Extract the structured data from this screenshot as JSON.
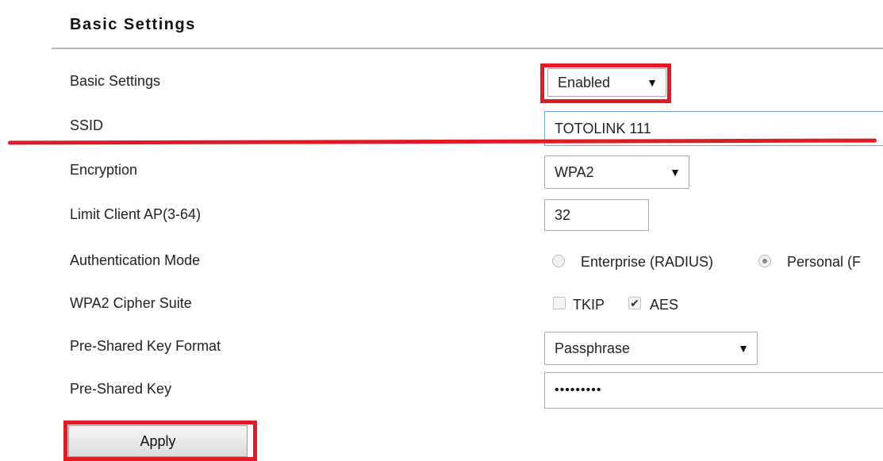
{
  "page": {
    "section_title": "Basic Settings"
  },
  "rows": {
    "basic_settings": {
      "label": "Basic Settings",
      "value": "Enabled"
    },
    "ssid": {
      "label": "SSID",
      "value": "TOTOLINK 111"
    },
    "encryption": {
      "label": "Encryption",
      "value": "WPA2"
    },
    "limit_client": {
      "label": "Limit Client AP(3-64)",
      "value": "32"
    },
    "auth_mode": {
      "label": "Authentication Mode",
      "options": [
        {
          "label": "Enterprise (RADIUS)",
          "selected": false
        },
        {
          "label": "Personal (F",
          "selected": true
        }
      ]
    },
    "cipher_suite": {
      "label": "WPA2 Cipher Suite",
      "options": [
        {
          "label": "TKIP",
          "checked": false
        },
        {
          "label": "AES",
          "checked": true
        }
      ]
    },
    "psk_format": {
      "label": "Pre-Shared Key Format",
      "value": "Passphrase"
    },
    "psk": {
      "label": "Pre-Shared Key",
      "value": "•••••••••"
    }
  },
  "actions": {
    "apply_label": "Apply"
  },
  "icons": {
    "dropdown": "dropdown-arrow-icon",
    "check": "checkmark-icon"
  },
  "colors": {
    "highlight": "#e01b24",
    "divider": "#b8b8b8"
  }
}
